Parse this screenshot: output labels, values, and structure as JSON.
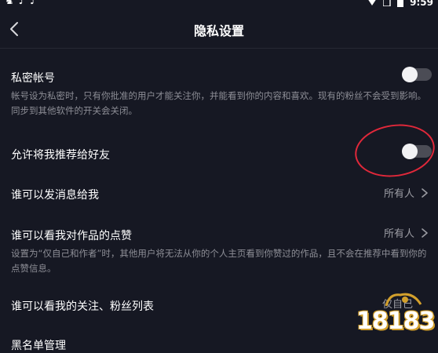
{
  "status_bar": {
    "left_icons": [
      "app-icon",
      "tiktok-icon",
      "tiktok-icon"
    ],
    "time": "9:59"
  },
  "header": {
    "title": "隐私设置"
  },
  "settings": {
    "private_account": {
      "label": "私密帐号",
      "description": "帐号设为私密时，只有你批准的用户才能关注你，并能看到你的内容和喜欢。现有的粉丝不会受到影响。同步到其他软件的开关会关闭。",
      "enabled": false
    },
    "recommend_to_friends": {
      "label": "允许将我推荐给好友",
      "enabled": false
    },
    "who_can_message": {
      "label": "谁可以发消息给我",
      "value": "所有人"
    },
    "who_can_see_likes": {
      "label": "谁可以看我对作品的点赞",
      "value": "所有人",
      "description": "设置为“仅自己和作者”时，其他用户将无法从你的个人主页看到你赞过的作品，且不会在推荐中看到你的点赞信息。"
    },
    "who_can_see_follow_list": {
      "label": "谁可以看我的关注、粉丝列表",
      "value": "仅自己"
    },
    "blacklist": {
      "label": "黑名单管理"
    }
  },
  "colors": {
    "background": "#161823",
    "annotation_red": "#e0283a",
    "toggle_off_track": "#4b4c55"
  },
  "watermark": {
    "text": "18183"
  }
}
